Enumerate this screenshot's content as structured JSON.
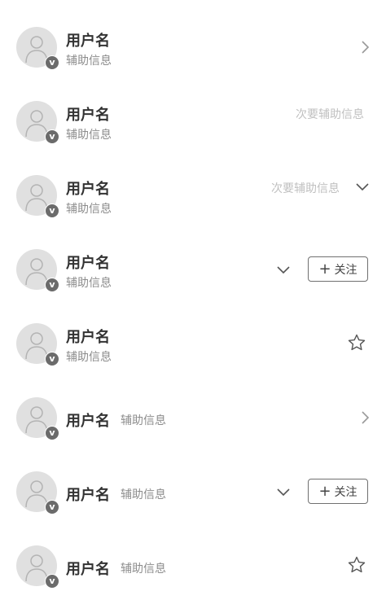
{
  "rows": [
    {
      "name": "用户名",
      "sub": "辅助信息",
      "trailing": "chevron-right"
    },
    {
      "name": "用户名",
      "sub": "辅助信息",
      "secondary": "次要辅助信息"
    },
    {
      "name": "用户名",
      "sub": "辅助信息",
      "secondary": "次要辅助信息",
      "trailing": "chevron-down"
    },
    {
      "name": "用户名",
      "sub": "辅助信息",
      "trailing": "chevron-down",
      "button": {
        "icon": "+",
        "label": "关注"
      }
    },
    {
      "name": "用户名",
      "sub": "辅助信息",
      "trailing": "star"
    },
    {
      "name": "用户名",
      "sub": "辅助信息",
      "trailing": "chevron-right"
    },
    {
      "name": "用户名",
      "sub": "辅助信息",
      "trailing": "chevron-down",
      "button": {
        "icon": "+",
        "label": "关注"
      }
    },
    {
      "name": "用户名",
      "sub": "辅助信息",
      "trailing": "star"
    }
  ],
  "badge": "v",
  "colors": {
    "avatar_bg": "#e0e0e0",
    "badge_bg": "#6b6b6b",
    "name": "#333333",
    "sub": "#8c8c8c",
    "secondary": "#c0c0c0",
    "icon": "#888888"
  }
}
